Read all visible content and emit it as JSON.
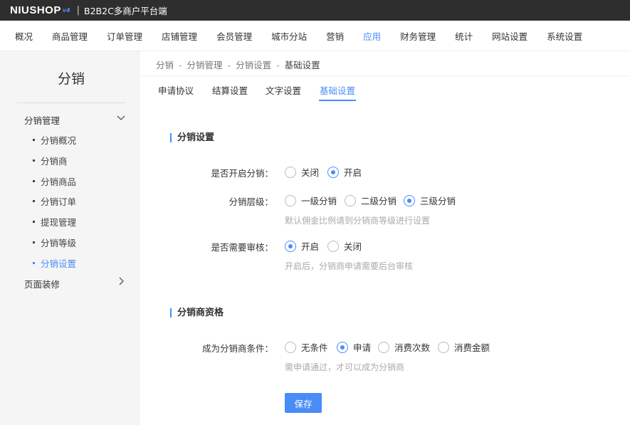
{
  "header": {
    "logo": "NIUSHOP",
    "logo_tag": "v4",
    "separator": "|",
    "platform": "B2B2C多商户平台端"
  },
  "main_nav": {
    "items": [
      "概况",
      "商品管理",
      "订单管理",
      "店铺管理",
      "会员管理",
      "城市分站",
      "营销",
      "应用",
      "财务管理",
      "统计",
      "网站设置",
      "系统设置"
    ],
    "active": "应用"
  },
  "sidebar": {
    "title": "分销",
    "group1": "分销管理",
    "items": [
      "分销概况",
      "分销商",
      "分销商品",
      "分销订单",
      "提现管理",
      "分销等级",
      "分销设置"
    ],
    "active": "分销设置",
    "group2": "页面装修"
  },
  "breadcrumb": {
    "items": [
      "分销",
      "分销管理",
      "分销设置",
      "基础设置"
    ],
    "separator": "-"
  },
  "tabs": {
    "items": [
      "申请协议",
      "结算设置",
      "文字设置",
      "基础设置"
    ],
    "active": "基础设置"
  },
  "section1": {
    "title": "分销设置",
    "enable": {
      "label": "是否开启分销：",
      "options": [
        "关闭",
        "开启"
      ],
      "selected": "开启"
    },
    "level": {
      "label": "分销层级：",
      "options": [
        "一级分销",
        "二级分销",
        "三级分销"
      ],
      "selected": "三级分销",
      "hint": "默认佣金比例请到分销商等级进行设置"
    },
    "audit": {
      "label": "是否需要审核：",
      "options": [
        "开启",
        "关闭"
      ],
      "selected": "开启",
      "hint": "开启后，分销商申请需要后台审核"
    }
  },
  "section2": {
    "title": "分销商资格",
    "condition": {
      "label": "成为分销商条件：",
      "options": [
        "无条件",
        "申请",
        "消费次数",
        "消费金额"
      ],
      "selected": "申请",
      "hint": "需申请通过，才可以成为分销商"
    }
  },
  "actions": {
    "save": "保存"
  },
  "colors": {
    "accent": "#4a8cf7",
    "topbar": "#2e2e2e",
    "sidebar": "#f5f5f5"
  }
}
